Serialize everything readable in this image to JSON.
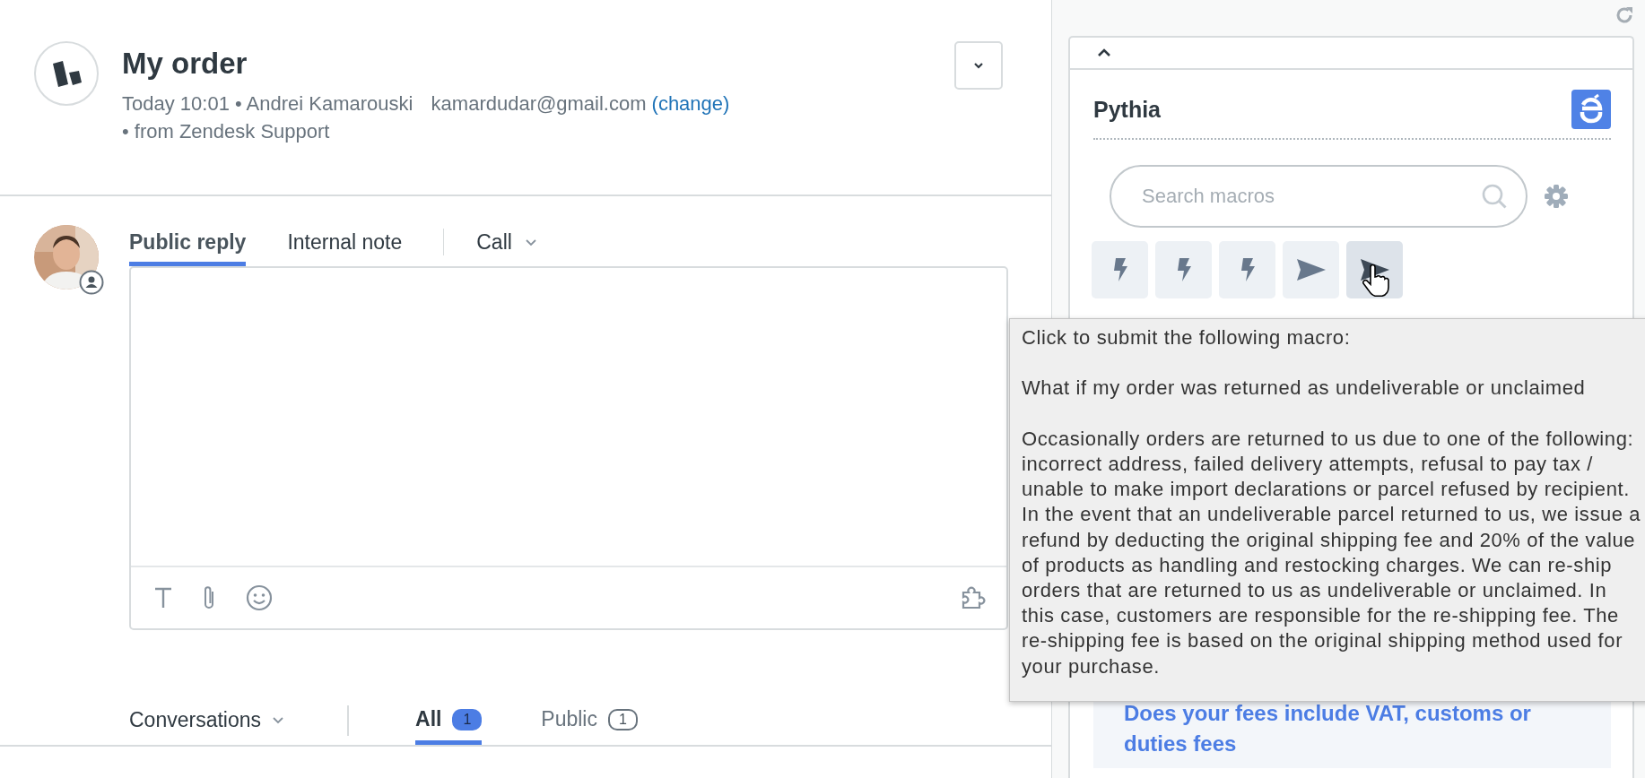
{
  "ticket": {
    "title": "My order",
    "time_author": "Today 10:01 • Andrei Kamarouski",
    "email": "kamardudar@gmail.com",
    "change_link": "(change)",
    "source": "• from Zendesk Support"
  },
  "composer": {
    "tabs": [
      {
        "label": "Public reply",
        "selected": true,
        "kind": "tab"
      },
      {
        "label": "Internal note",
        "selected": false,
        "kind": "tab"
      },
      {
        "label": "Call",
        "selected": false,
        "kind": "dropdown"
      }
    ]
  },
  "conversations": {
    "filter": "Conversations",
    "tabs": [
      {
        "label": "All",
        "count": "1",
        "selected": true
      },
      {
        "label": "Public",
        "count": "1",
        "selected": false
      }
    ]
  },
  "app": {
    "name": "Pythia",
    "search": {
      "placeholder": "Search macros"
    },
    "macro_buttons": [
      {
        "kind": "lightning",
        "hovered": false
      },
      {
        "kind": "lightning",
        "hovered": false
      },
      {
        "kind": "lightning",
        "hovered": false
      },
      {
        "kind": "send",
        "hovered": false
      },
      {
        "kind": "send",
        "hovered": true
      }
    ],
    "article_link": "Does your fees include VAT, customs or duties fees"
  },
  "tooltip": {
    "intro": "Click to submit the following macro:",
    "macro_title": "What if my order was returned as undeliverable or unclaimed",
    "body_lines": [
      "Occasionally orders are returned to us due to one of the following:",
      "incorrect address, failed delivery attempts, refusal to pay tax /",
      "unable to make import declarations or parcel refused by recipient.",
      "In the event that an undeliverable parcel returned to us, we issue a",
      "refund by deducting the original shipping fee and 20% of the value",
      "of products as handling and restocking charges. We can re-ship",
      "orders that are returned to us as undeliverable or unclaimed. In",
      "this case, customers are responsible for the re-shipping fee. The",
      "re-shipping fee is based on the original shipping method used for",
      "your purchase."
    ]
  }
}
